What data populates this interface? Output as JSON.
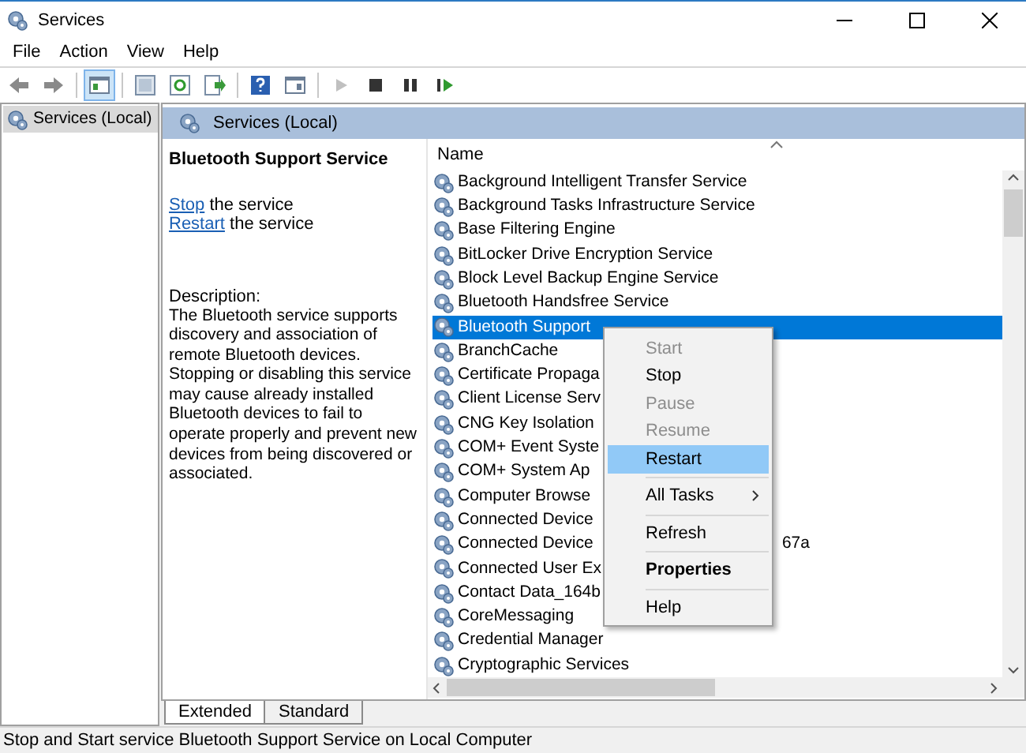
{
  "window": {
    "title": "Services"
  },
  "menu_bar": [
    "File",
    "Action",
    "View",
    "Help"
  ],
  "toolbar": [
    [
      {
        "kind": "back",
        "disabled": false,
        "pressed": false
      },
      {
        "kind": "forward",
        "disabled": false,
        "pressed": false
      }
    ],
    [
      {
        "kind": "tree",
        "disabled": false,
        "pressed": true
      }
    ],
    [
      {
        "kind": "console",
        "disabled": false,
        "pressed": false
      },
      {
        "kind": "refresh",
        "disabled": false,
        "pressed": false
      },
      {
        "kind": "export",
        "disabled": false,
        "pressed": false
      }
    ],
    [
      {
        "kind": "help",
        "disabled": false,
        "pressed": false
      },
      {
        "kind": "pane",
        "disabled": false,
        "pressed": false
      }
    ],
    [
      {
        "kind": "play",
        "disabled": true,
        "pressed": false
      },
      {
        "kind": "stop",
        "disabled": false,
        "pressed": false
      },
      {
        "kind": "pause",
        "disabled": false,
        "pressed": false
      },
      {
        "kind": "restart",
        "disabled": false,
        "pressed": false
      }
    ]
  ],
  "tree": [
    {
      "label": "Services (Local)",
      "selected": true
    }
  ],
  "pane_header": "Services (Local)",
  "details": {
    "title": "Bluetooth Support Service",
    "actions": [
      {
        "link": "Stop",
        "text": " the service"
      },
      {
        "link": "Restart",
        "text": " the service"
      }
    ],
    "description_label": "Description:",
    "description": "The Bluetooth service supports discovery and association of remote Bluetooth devices.  Stopping or disabling this service may cause already installed Bluetooth devices to fail to operate properly and prevent new devices from being discovered or associated."
  },
  "list": {
    "column": "Name",
    "rows": [
      {
        "name": "Background Intelligent Transfer Service",
        "selected": false
      },
      {
        "name": "Background Tasks Infrastructure Service",
        "selected": false
      },
      {
        "name": "Base Filtering Engine",
        "selected": false
      },
      {
        "name": "BitLocker Drive Encryption Service",
        "selected": false
      },
      {
        "name": "Block Level Backup Engine Service",
        "selected": false
      },
      {
        "name": "Bluetooth Handsfree Service",
        "selected": false
      },
      {
        "name": "Bluetooth Support",
        "selected": true
      },
      {
        "name": "BranchCache",
        "selected": false
      },
      {
        "name": "Certificate Propaga",
        "selected": false
      },
      {
        "name": "Client License Serv",
        "selected": false
      },
      {
        "name": "CNG Key Isolation",
        "selected": false
      },
      {
        "name": "COM+ Event Syste",
        "selected": false
      },
      {
        "name": "COM+ System Ap",
        "selected": false
      },
      {
        "name": "Computer Browse",
        "selected": false
      },
      {
        "name": "Connected Device",
        "selected": false
      },
      {
        "name": "Connected Device",
        "tail": "67a",
        "selected": false
      },
      {
        "name": "Connected User Ex",
        "selected": false
      },
      {
        "name": "Contact Data_164b",
        "selected": false
      },
      {
        "name": "CoreMessaging",
        "selected": false
      },
      {
        "name": "Credential Manager",
        "selected": false
      },
      {
        "name": "Cryptographic Services",
        "selected": false
      }
    ]
  },
  "context_menu": [
    {
      "label": "Start",
      "kind": "item",
      "disabled": true,
      "highlighted": false,
      "default": false,
      "separator_after": false
    },
    {
      "label": "Stop",
      "kind": "item",
      "disabled": false,
      "highlighted": false,
      "default": false,
      "separator_after": false
    },
    {
      "label": "Pause",
      "kind": "item",
      "disabled": true,
      "highlighted": false,
      "default": false,
      "separator_after": false
    },
    {
      "label": "Resume",
      "kind": "item",
      "disabled": true,
      "highlighted": false,
      "default": false,
      "separator_after": false
    },
    {
      "label": "Restart",
      "kind": "item",
      "disabled": false,
      "highlighted": true,
      "default": false,
      "separator_after": true
    },
    {
      "label": "All Tasks",
      "kind": "submenu",
      "disabled": false,
      "highlighted": false,
      "default": false,
      "separator_after": true
    },
    {
      "label": "Refresh",
      "kind": "item",
      "disabled": false,
      "highlighted": false,
      "default": false,
      "separator_after": true
    },
    {
      "label": "Properties",
      "kind": "item",
      "disabled": false,
      "highlighted": false,
      "default": true,
      "separator_after": true
    },
    {
      "label": "Help",
      "kind": "item",
      "disabled": false,
      "highlighted": false,
      "default": false,
      "separator_after": false
    }
  ],
  "tabs": [
    {
      "label": "Extended",
      "selected": true
    },
    {
      "label": "Standard",
      "selected": false
    }
  ],
  "status_bar": "Stop and Start service Bluetooth Support Service on Local Computer"
}
